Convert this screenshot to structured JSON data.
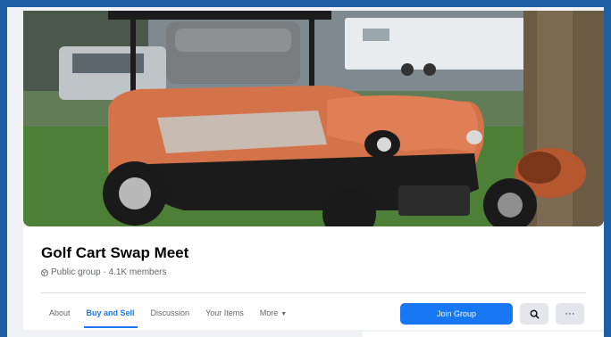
{
  "group": {
    "name": "Golf Cart Swap Meet",
    "meta": "Public group · 4.1K members",
    "privacy_icon": "globe-icon"
  },
  "tabs": [
    {
      "label": "About",
      "active": false
    },
    {
      "label": "Buy and Sell",
      "active": true
    },
    {
      "label": "Discussion",
      "active": false
    },
    {
      "label": "Your Items",
      "active": false
    },
    {
      "label": "More",
      "active": false,
      "icon": "caret-down-icon"
    }
  ],
  "actions": {
    "join_label": "Join Group",
    "search_icon": "search-icon",
    "more_icon": "ellipsis-icon"
  },
  "colors": {
    "accent": "#1877f2",
    "frame": "#1f5fa6",
    "page_bg": "#f0f2f5",
    "secondary_button": "#e4e6eb"
  }
}
